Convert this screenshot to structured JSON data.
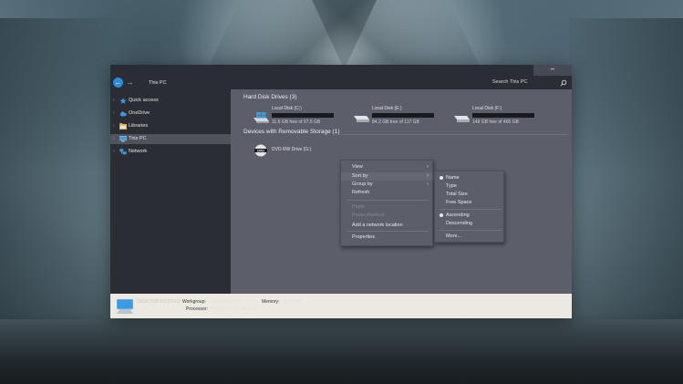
{
  "window": {
    "address": "This PC",
    "search_placeholder": "Search This PC"
  },
  "sidebar": {
    "items": [
      {
        "label": "Quick access",
        "icon": "star-icon"
      },
      {
        "label": "OneDrive",
        "icon": "cloud-icon"
      },
      {
        "label": "Libraries",
        "icon": "folder-icon"
      },
      {
        "label": "This PC",
        "icon": "computer-icon",
        "selected": true
      },
      {
        "label": "Network",
        "icon": "network-icon"
      }
    ]
  },
  "content": {
    "hard_disk_title": "Hard Disk Drives (3)",
    "removable_title": "Devices with Removable Storage (1)",
    "drives": [
      {
        "label": "Local Disk (C:)",
        "free": "11.6 GB free of 97.5 GB"
      },
      {
        "label": "Local Disk (E:)",
        "free": "84.2 GB free of 117 GB"
      },
      {
        "label": "Local Disk (F:)",
        "free": "149 GB free of 465 GB"
      }
    ],
    "dvd": {
      "label": "DVD RW Drive (G:)",
      "badge": "DVD"
    }
  },
  "context_menu": {
    "items": [
      "View",
      "Sort by",
      "Group by",
      "Refresh",
      "Paste",
      "Paste shortcut",
      "Add a network location",
      "Properties"
    ]
  },
  "sort_menu": {
    "items": [
      "Name",
      "Type",
      "Total Size",
      "Free Space",
      "Ascending",
      "Descending",
      "More..."
    ]
  },
  "details": {
    "computer_name": "DESKTOP-POJTFG2",
    "workgroup_label": "Workgroup:",
    "workgroup_value": "WORKGROUP",
    "memory_label": "Memory:",
    "memory_value": "8.00 GB",
    "processor_label": "Processor:",
    "processor_value": "Intel(R) Core(TM) i5-3..."
  },
  "colors": {
    "accent": "#2a8dd9",
    "window_bg": "#5c5f69",
    "sidebar_bg": "#2b2d34",
    "details_bg": "#ece9e2"
  }
}
